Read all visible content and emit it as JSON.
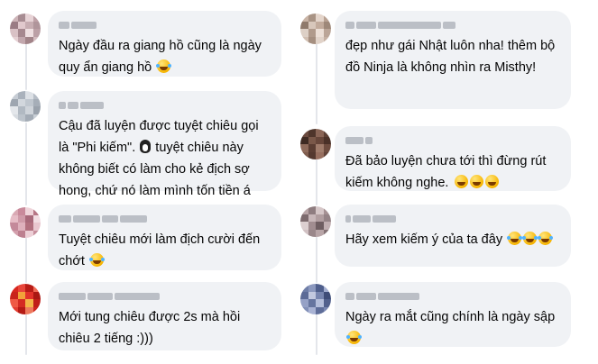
{
  "left_comments": [
    {
      "avatar_colors": [
        "#cdb4b8",
        "#a78c92",
        "#e7d3d6",
        "#bfa2a8",
        "#9a7c84",
        "#e1c9cd",
        "#c7adb2",
        "#b0959b",
        "#d9c1c5",
        "#a6888f",
        "#efdfe1",
        "#bca0a6",
        "#e5d0d3",
        "#c2a7ad",
        "#a28489",
        "#d4bcc0"
      ],
      "text": "Ngày đầu ra giang hồ cũng là ngày quy ẩn giang hồ",
      "emoji": "grinning-tears-emoji"
    },
    {
      "avatar_colors": [
        "#c6ccd4",
        "#aab2bc",
        "#dde1e6",
        "#b7bec7",
        "#9ea6b0",
        "#d2d7dd",
        "#c0c7cf",
        "#a6aeb8",
        "#e4e7eb",
        "#b1b9c2",
        "#cfd4da",
        "#9aa2ac",
        "#d8dce1",
        "#bcc3cb",
        "#a3abb5",
        "#c9cfd6"
      ],
      "text_before": "Cậu đã luyện được tuyệt chiêu gọi là \"Phi kiếm\". ",
      "text_after": " tuyệt chiêu này không biết có làm cho kẻ địch sợ hong, chứ nó làm mình tốn tiền á",
      "emoji": "penguin-icon"
    },
    {
      "avatar_colors": [
        "#d9a9b4",
        "#c98a9b",
        "#efd4da",
        "#b77786",
        "#e6bcc6",
        "#cf9aa8",
        "#a8697a",
        "#f2dde2",
        "#c4899a",
        "#deb0bc",
        "#b2707f",
        "#e9c7cf",
        "#d39fac",
        "#bd8090",
        "#edd0d7",
        "#c7909e"
      ],
      "text": "Tuyệt chiêu mới làm địch cười đến chớt",
      "emoji": "rolling-laughing-emoji"
    },
    {
      "avatar_colors": [
        "#d8261f",
        "#e8453a",
        "#b81c16",
        "#f06a55",
        "#c9231c",
        "#f2a23a",
        "#e2322a",
        "#aa1812",
        "#ef5a45",
        "#d42b22",
        "#f3b548",
        "#c01f19",
        "#e33d31",
        "#b51b15",
        "#ee7a5e",
        "#cf2620"
      ],
      "text": "Mới tung chiêu được 2s mà hồi chiêu 2 tiếng :)))"
    }
  ],
  "right_comments": [
    {
      "avatar_colors": [
        "#c9b4a6",
        "#a89384",
        "#e4d5cb",
        "#b9a293",
        "#8f7a6c",
        "#d8c7bb",
        "#c2ab9c",
        "#9e8879",
        "#ddd0c6",
        "#b09a8b",
        "#ecdfd6",
        "#bba597",
        "#d1bfb2",
        "#a58f80",
        "#e1d3c9",
        "#c6b1a3"
      ],
      "text": "đẹp như gái Nhật luôn nha! thêm bộ đồ Ninja là không nhìn ra Misthy!"
    },
    {
      "avatar_colors": [
        "#6b4a3e",
        "#4f352b",
        "#8a6556",
        "#5c3f34",
        "#3e2a22",
        "#7a5849",
        "#67463a",
        "#4a3128",
        "#8f6b5b",
        "#5a3d32",
        "#a07c6b",
        "#6f4d40",
        "#805e4f",
        "#54392f",
        "#976f5f",
        "#62443a"
      ],
      "text": "Đã bảo luyện chưa tới thì đừng rút kiếm không nghe.",
      "emoji_count": 3,
      "emoji": "grinning-emoji"
    },
    {
      "avatar_colors": [
        "#b9a6a8",
        "#8f7d80",
        "#d6c7c8",
        "#a69294",
        "#7d6b6e",
        "#c8b7b9",
        "#b19ea0",
        "#958386",
        "#dccfd0",
        "#a18d90",
        "#6f5e61",
        "#c1afb1",
        "#d1c1c3",
        "#9a878a",
        "#b8a5a7",
        "#857376"
      ],
      "text": "Hãy xem kiếm ý của ta đây",
      "emoji_count": 3,
      "emoji": "grinning-tears-emoji"
    },
    {
      "avatar_colors": [
        "#6f7ea8",
        "#8b98be",
        "#4f5f8c",
        "#a3aed0",
        "#5c6b97",
        "#c2c9e0",
        "#7886b0",
        "#3f4d78",
        "#95a1c6",
        "#66759f",
        "#b5bfdb",
        "#52618d",
        "#8290b8",
        "#a9b3d4",
        "#5e6d99",
        "#7b89b3"
      ],
      "text": "Ngày ra mắt cũng chính là ngày sập",
      "emoji": "grinning-tears-emoji"
    }
  ]
}
